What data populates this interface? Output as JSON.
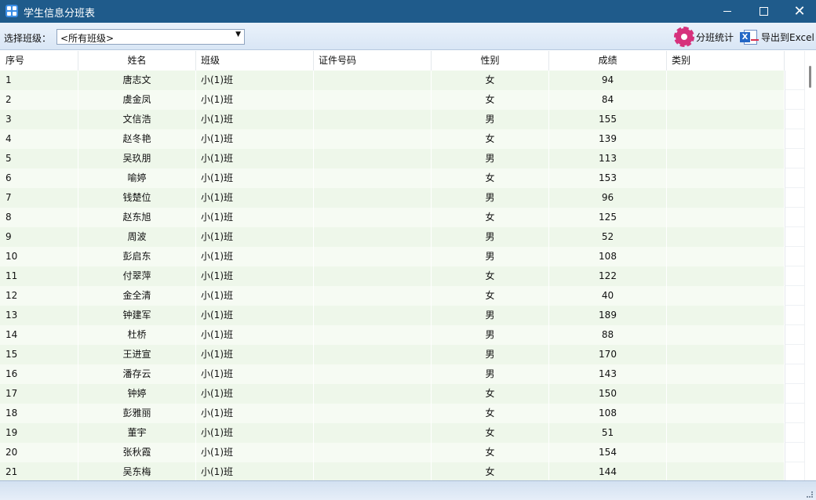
{
  "window": {
    "title": "学生信息分班表"
  },
  "toolbar": {
    "class_label": "选择班级：",
    "class_value": "<所有班级>",
    "stats_label": "分班统计",
    "export_label": "导出到Excel"
  },
  "table": {
    "columns": [
      "序号",
      "姓名",
      "班级",
      "证件号码",
      "性别",
      "成绩",
      "类别"
    ],
    "rows": [
      [
        "1",
        "唐志文",
        "小(1)班",
        "",
        "女",
        "94",
        ""
      ],
      [
        "2",
        "虞金凤",
        "小(1)班",
        "",
        "女",
        "84",
        ""
      ],
      [
        "3",
        "文信浩",
        "小(1)班",
        "",
        "男",
        "155",
        ""
      ],
      [
        "4",
        "赵冬艳",
        "小(1)班",
        "",
        "女",
        "139",
        ""
      ],
      [
        "5",
        "吴玖朋",
        "小(1)班",
        "",
        "男",
        "113",
        ""
      ],
      [
        "6",
        "喻婷",
        "小(1)班",
        "",
        "女",
        "153",
        ""
      ],
      [
        "7",
        "钱楚位",
        "小(1)班",
        "",
        "男",
        "96",
        ""
      ],
      [
        "8",
        "赵东旭",
        "小(1)班",
        "",
        "女",
        "125",
        ""
      ],
      [
        "9",
        "周波",
        "小(1)班",
        "",
        "男",
        "52",
        ""
      ],
      [
        "10",
        "彭启东",
        "小(1)班",
        "",
        "男",
        "108",
        ""
      ],
      [
        "11",
        "付翠萍",
        "小(1)班",
        "",
        "女",
        "122",
        ""
      ],
      [
        "12",
        "金全清",
        "小(1)班",
        "",
        "女",
        "40",
        ""
      ],
      [
        "13",
        "钟建军",
        "小(1)班",
        "",
        "男",
        "189",
        ""
      ],
      [
        "14",
        "杜桥",
        "小(1)班",
        "",
        "男",
        "88",
        ""
      ],
      [
        "15",
        "王进宣",
        "小(1)班",
        "",
        "男",
        "170",
        ""
      ],
      [
        "16",
        "潘存云",
        "小(1)班",
        "",
        "男",
        "143",
        ""
      ],
      [
        "17",
        "钟婷",
        "小(1)班",
        "",
        "女",
        "150",
        ""
      ],
      [
        "18",
        "彭雅丽",
        "小(1)班",
        "",
        "女",
        "108",
        ""
      ],
      [
        "19",
        "董宇",
        "小(1)班",
        "",
        "女",
        "51",
        ""
      ],
      [
        "20",
        "张秋霞",
        "小(1)班",
        "",
        "女",
        "154",
        ""
      ],
      [
        "21",
        "吴东梅",
        "小(1)班",
        "",
        "女",
        "144",
        ""
      ]
    ]
  },
  "colors": {
    "titlebar": "#1f5b8b",
    "row_even": "#eef7ea",
    "row_odd": "#f6fbf3",
    "stats_icon": "#d6317c",
    "excel_icon": "#2367c6"
  },
  "icons": {
    "app": "app-grid-icon",
    "stats": "gear-icon",
    "export": "excel-export-icon"
  }
}
